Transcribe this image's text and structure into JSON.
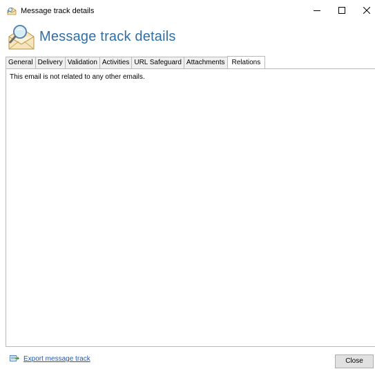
{
  "window": {
    "title": "Message track details",
    "title_icon": "message-search-icon",
    "controls": {
      "minimize": "minimize-icon",
      "maximize": "maximize-icon",
      "close": "close-icon"
    }
  },
  "header": {
    "title": "Message track details",
    "icon": "envelope-magnifier-icon",
    "title_color": "#2e6fa8"
  },
  "tabs": [
    {
      "label": "General",
      "active": false
    },
    {
      "label": "Delivery",
      "active": false
    },
    {
      "label": "Validation",
      "active": false
    },
    {
      "label": "Activities",
      "active": false
    },
    {
      "label": "URL Safeguard",
      "active": false
    },
    {
      "label": "Attachments",
      "active": false
    },
    {
      "label": "Relations",
      "active": true
    }
  ],
  "relations": {
    "message": "This email is not related to any other emails."
  },
  "footer": {
    "export_label": "Export message track",
    "export_icon": "export-icon",
    "close_label": "Close",
    "link_color": "#1a56b8"
  }
}
